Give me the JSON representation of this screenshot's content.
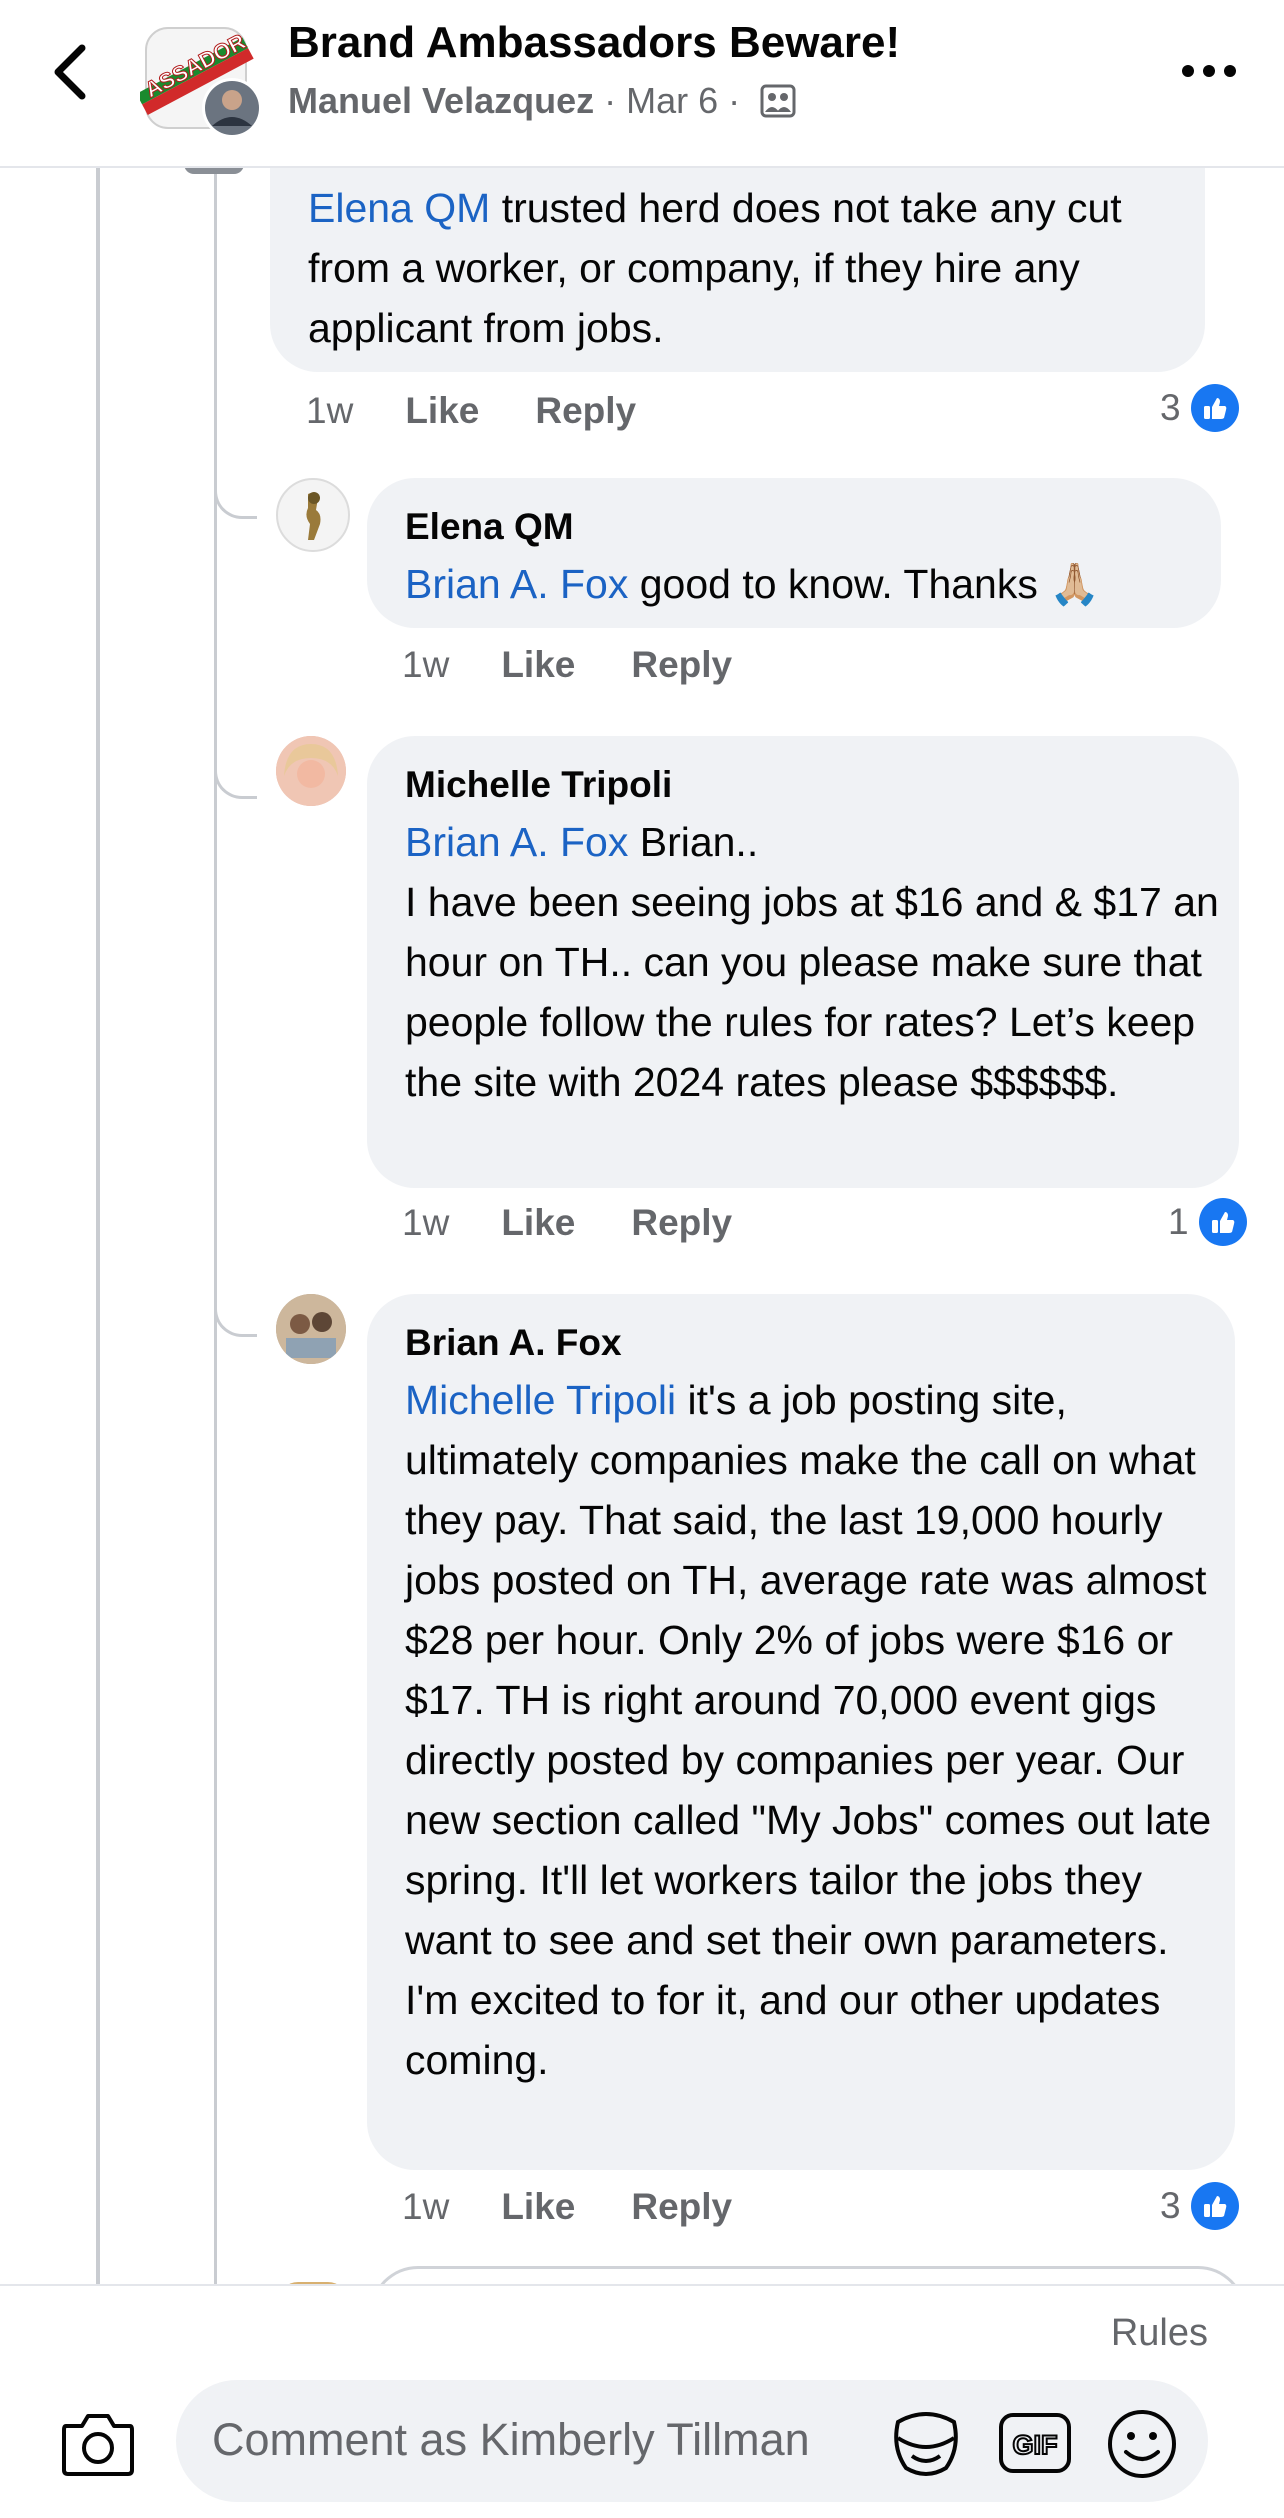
{
  "header": {
    "title": "Brand Ambassadors Beware!",
    "author": "Manuel Velazquez",
    "date": "Mar 6",
    "separator": "·"
  },
  "comments": [
    {
      "mention": "Elena QM",
      "text": " trusted herd does not take any cut from a worker, or company, if they hire any applicant from jobs.",
      "time": "1w",
      "like_label": "Like",
      "reply_label": "Reply",
      "reaction_count": "3"
    },
    {
      "author": "Elena QM",
      "mention": "Brian A. Fox",
      "text": " good to know. Thanks 🙏🏼",
      "time": "1w",
      "like_label": "Like",
      "reply_label": "Reply"
    },
    {
      "author": "Michelle Tripoli",
      "mention": "Brian A. Fox",
      "text": " Brian..\nI have been seeing jobs at $16 and & $17 an hour on TH.. can you please make sure that people follow the rules for rates? Let’s keep the site with 2024 rates please $$$$$$.",
      "time": "1w",
      "like_label": "Like",
      "reply_label": "Reply",
      "reaction_count": "1"
    },
    {
      "author": "Brian A. Fox",
      "mention": "Michelle Tripoli",
      "text": " it's a job posting site, ultimately companies make the call on what they pay. That said, the last 19,000 hourly jobs posted on TH, average rate was almost $28 per hour. Only 2% of jobs were $16 or $17. TH is right around 70,000 event gigs directly posted by companies per year. Our new section called \"My Jobs\" comes out late spring. It'll let workers tailor the jobs they want to see and set their own parameters. I'm excited to for it, and our other updates coming.",
      "time": "1w",
      "like_label": "Like",
      "reply_label": "Reply",
      "reaction_count": "3"
    }
  ],
  "footer": {
    "rules_label": "Rules",
    "comment_placeholder": "Comment as Kimberly Tillman",
    "gif_label": "GIF"
  },
  "icons": {
    "back": "chevron-left-icon",
    "more": "more-horizontal-icon",
    "privacy": "group-icon",
    "like": "thumbs-up-icon",
    "camera": "camera-icon",
    "sticker": "sticker-icon",
    "gif": "gif-icon",
    "emoji": "smiley-icon"
  },
  "colors": {
    "mention": "#1b63c4",
    "like_badge": "#1877f2",
    "bubble": "#f0f2f5",
    "secondary_text": "#65676b"
  }
}
